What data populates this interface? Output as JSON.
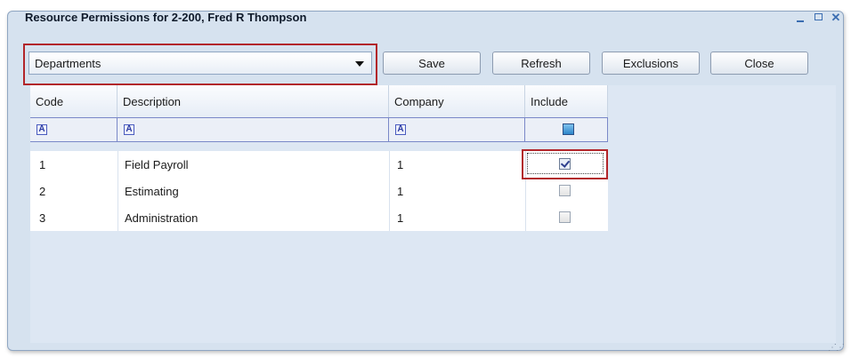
{
  "window": {
    "title": "Resource Permissions for 2-200, Fred R Thompson",
    "controls": [
      "minimize-icon",
      "maximize-icon",
      "close-icon"
    ]
  },
  "toolbar": {
    "dropdown_value": "Departments",
    "save_label": "Save",
    "refresh_label": "Refresh",
    "exclusions_label": "Exclusions",
    "close_label": "Close"
  },
  "grid": {
    "columns": [
      "Code",
      "Description",
      "Company",
      "Include"
    ],
    "filter_icon_text": "A",
    "rows": [
      {
        "code": "1",
        "description": "Field Payroll",
        "company": "1",
        "include": true
      },
      {
        "code": "2",
        "description": "Estimating",
        "company": "1",
        "include": false
      },
      {
        "code": "3",
        "description": "Administration",
        "company": "1",
        "include": false
      }
    ]
  },
  "colors": {
    "highlight": "#b2252a",
    "window_bg": "#d6e2ef"
  }
}
